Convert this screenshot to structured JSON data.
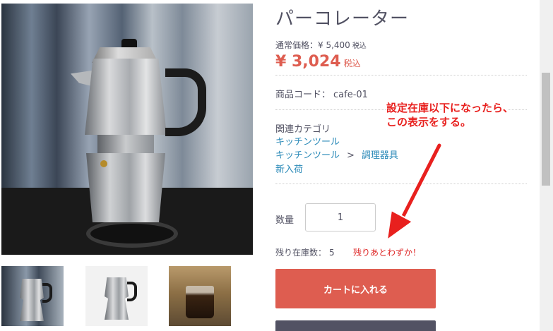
{
  "product": {
    "title": "パーコレーター",
    "regular_price_label": "通常価格：¥ 5,400",
    "regular_price_tax": "税込",
    "sale_price": "¥ 3,024",
    "sale_price_tax": "税込",
    "code_label": "商品コード：",
    "code_value": "cafe-01"
  },
  "categories": {
    "heading": "関連カテゴリ",
    "links": [
      "キッチンツール",
      "キッチンツール",
      "調理器具",
      "新入荷"
    ],
    "separator": ">"
  },
  "quantity": {
    "label": "数量",
    "value": "1"
  },
  "stock": {
    "label": "残り在庫数：",
    "count": "5",
    "warning": "残りあとわずか！"
  },
  "actions": {
    "cart_label": "カートに入れる"
  },
  "annotation": {
    "line1": "設定在庫以下になったら、",
    "line2": "この表示をする。"
  },
  "colors": {
    "accent": "#de5d50",
    "link": "#2b8ab8",
    "warning": "#de2626",
    "annotation": "#e8201e"
  }
}
